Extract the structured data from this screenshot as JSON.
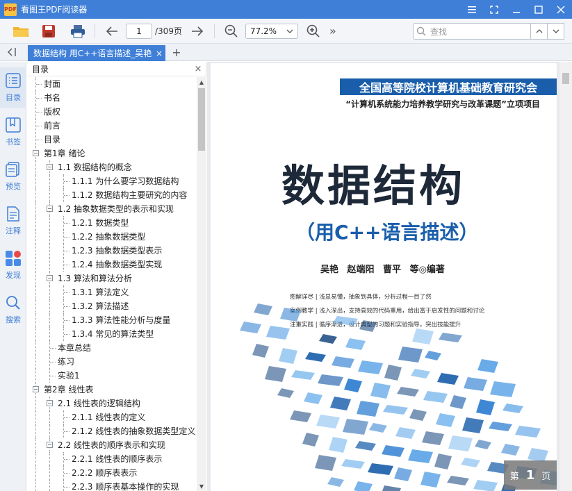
{
  "app": {
    "logo_text": "PDF",
    "title": "看图王PDF阅读器",
    "window_controls": [
      "menu-icon",
      "fullscreen-icon",
      "minimize-icon",
      "maximize-icon",
      "close-icon"
    ]
  },
  "toolbar": {
    "page_current": "1",
    "page_total": "/309页",
    "zoom": "77.2%",
    "search_placeholder": "查找",
    "more": "»"
  },
  "tabs": {
    "collapse": "‹|",
    "active_tab_label": "数据结构 用C++语言描述_吴艳",
    "tab_close": "×",
    "add_tab": "+"
  },
  "rail": {
    "items": [
      {
        "label": "目录",
        "icon": "toc-icon"
      },
      {
        "label": "书签",
        "icon": "bookmark-icon"
      },
      {
        "label": "预览",
        "icon": "thumbnails-icon"
      },
      {
        "label": "注释",
        "icon": "annotation-icon"
      },
      {
        "label": "发现",
        "icon": "discover-icon"
      },
      {
        "label": "搜索",
        "icon": "search-icon"
      }
    ]
  },
  "toc": {
    "title": "目录",
    "close": "×",
    "items": [
      {
        "level": 0,
        "text": "封面"
      },
      {
        "level": 0,
        "text": "书名"
      },
      {
        "level": 0,
        "text": "版权"
      },
      {
        "level": 0,
        "text": "前言"
      },
      {
        "level": 0,
        "text": "目录"
      },
      {
        "level": 0,
        "text": "第1章 绪论",
        "expandable": true
      },
      {
        "level": 1,
        "text": "1.1 数据结构的概念",
        "expandable": true
      },
      {
        "level": 2,
        "text": "1.1.1 为什么要学习数据结构"
      },
      {
        "level": 2,
        "text": "1.1.2 数据结构主要研究的内容"
      },
      {
        "level": 1,
        "text": "1.2 抽象数据类型的表示和实现",
        "expandable": true
      },
      {
        "level": 2,
        "text": "1.2.1 数据类型"
      },
      {
        "level": 2,
        "text": "1.2.2 抽象数据类型"
      },
      {
        "level": 2,
        "text": "1.2.3 抽象数据类型表示"
      },
      {
        "level": 2,
        "text": "1.2.4 抽象数据类型实现"
      },
      {
        "level": 1,
        "text": "1.3 算法和算法分析",
        "expandable": true
      },
      {
        "level": 2,
        "text": "1.3.1 算法定义"
      },
      {
        "level": 2,
        "text": "1.3.2 算法描述"
      },
      {
        "level": 2,
        "text": "1.3.3 算法性能分析与度量"
      },
      {
        "level": 2,
        "text": "1.3.4 常见的算法类型"
      },
      {
        "level": 1,
        "text": "本章总结"
      },
      {
        "level": 1,
        "text": "练习"
      },
      {
        "level": 1,
        "text": "实验1"
      },
      {
        "level": 0,
        "text": "第2章 线性表",
        "expandable": true
      },
      {
        "level": 1,
        "text": "2.1 线性表的逻辑结构",
        "expandable": true
      },
      {
        "level": 2,
        "text": "2.1.1 线性表的定义"
      },
      {
        "level": 2,
        "text": "2.1.2 线性表的抽象数据类型定义"
      },
      {
        "level": 1,
        "text": "2.2 线性表的顺序表示和实现",
        "expandable": true
      },
      {
        "level": 2,
        "text": "2.2.1 线性表的顺序表示"
      },
      {
        "level": 2,
        "text": "2.2.2 顺序表表示"
      },
      {
        "level": 2,
        "text": "2.2.3 顺序表基本操作的实现"
      }
    ]
  },
  "cover": {
    "banner": "全国高等院校计算机基础教育研究会",
    "project": "“计算机系统能力培养教学研究与改革课题”立项项目",
    "title": "数据结构",
    "subtitle": "（用C++语言描述）",
    "authors": "吴艳  赵端阳  曹平  等◎编著",
    "features": [
      "图解详尽 | 浅显易懂，抽象到具体，分析过程一目了然",
      "案例教学 | 浅入深出，支持高效的代码重用，给出富于启发性的问题和讨论",
      "注重实践 | 循序渐进，设计典型的习题和实验指导，突出技能提升"
    ]
  },
  "page_indicator": {
    "prefix": "第",
    "number": "1",
    "suffix": "页"
  },
  "colors": {
    "accent": "#3f7fd8",
    "banner": "#1a5eab",
    "title": "#1d2838"
  }
}
